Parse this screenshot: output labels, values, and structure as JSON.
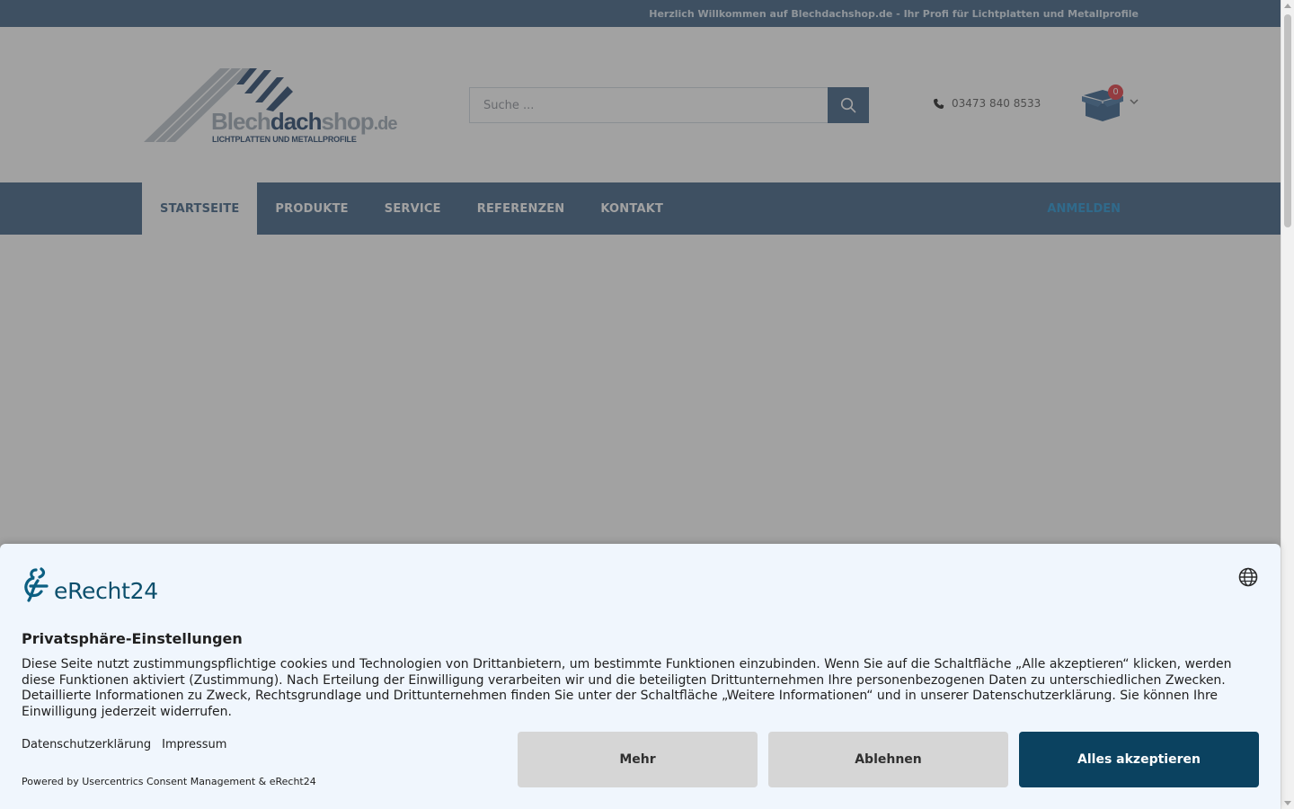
{
  "topbar": {
    "welcome": "Herzlich Willkommen auf Blechdachshop.de - Ihr Profi für Lichtplatten und Metallprofile"
  },
  "header": {
    "logo": {
      "word_blech": "Blech",
      "word_dach": "dach",
      "word_shop": "shop",
      "word_de": ".de",
      "tagline": "LICHTPLATTEN UND METALLPROFILE"
    },
    "search": {
      "placeholder": "Suche ..."
    },
    "phone": "03473 840 8533",
    "cart": {
      "count": "0"
    }
  },
  "nav": {
    "items": [
      {
        "label": "STARTSEITE"
      },
      {
        "label": "PRODUKTE"
      },
      {
        "label": "SERVICE"
      },
      {
        "label": "REFERENZEN"
      },
      {
        "label": "KONTAKT"
      }
    ],
    "login": "ANMELDEN"
  },
  "consent": {
    "brand": "eRecht24",
    "title": "Privatsphäre-Einstellungen",
    "description": "Diese Seite nutzt zustimmungspflichtige cookies und Technologien von Drittanbietern, um bestimmte Funktionen einzubinden. Wenn Sie auf die Schaltfläche „Alle akzeptieren“ klicken, werden diese Funktionen aktiviert (Zustimmung). Nach Erteilung der Einwilligung verarbeiten wir und die beteiligten Drittunternehmen Ihre personenbezogenen Daten zu unterschiedlichen Zwecken. Detaillierte Informationen zu Zweck, Rechtsgrundlage und Drittunternehmen finden Sie unter der Schaltfläche „Weitere Informationen“ und in unserer Datenschutzerklärung. Sie können Ihre Einwilligung jederzeit widerrufen.",
    "links": {
      "privacy": "Datenschutzerklärung",
      "imprint": "Impressum"
    },
    "powered_by": "Powered by Usercentrics Consent Management & eRecht24",
    "buttons": {
      "more": "Mehr",
      "decline": "Ablehnen",
      "accept_all": "Alles akzeptieren"
    }
  },
  "colors": {
    "brand_blue": "#375a7f",
    "consent_primary": "#0b4260",
    "consent_background": "#f0f6fd",
    "badge_red": "#e2333a"
  },
  "icons": {
    "search": "search-icon",
    "phone": "phone-icon",
    "cart": "cart-box-icon",
    "globe": "globe-icon",
    "chevron": "chevron-down-icon"
  }
}
